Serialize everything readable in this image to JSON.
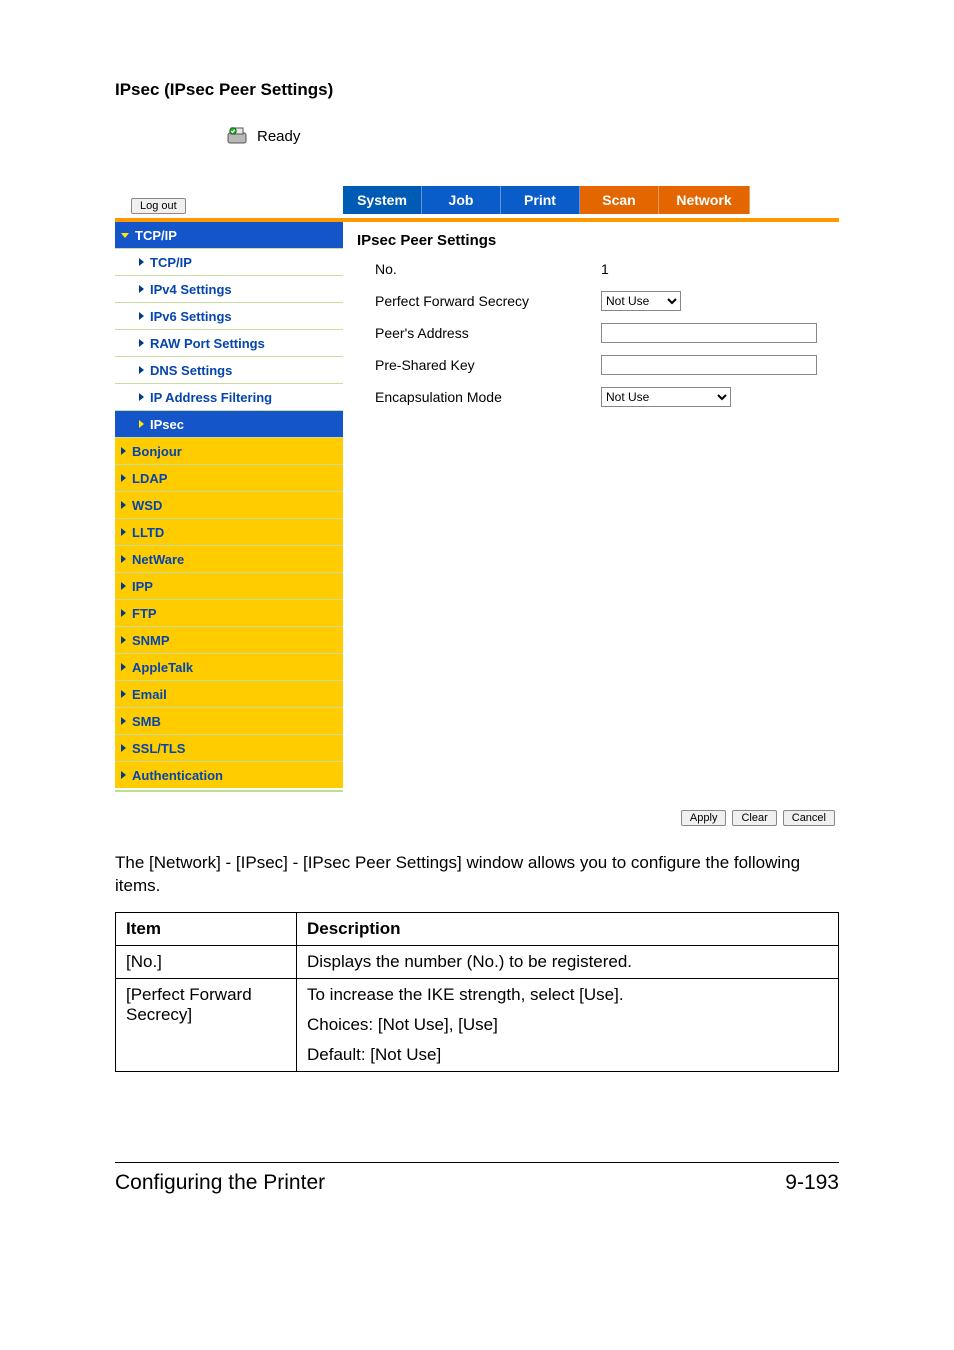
{
  "section_title": "IPsec (IPsec Peer Settings)",
  "status": {
    "text": "Ready"
  },
  "header": {
    "logout_label": "Log out",
    "tabs": {
      "system": "System",
      "job": "Job",
      "print": "Print",
      "scan": "Scan",
      "network": "Network"
    }
  },
  "sidebar": {
    "group": "TCP/IP",
    "subs": [
      "TCP/IP",
      "IPv4 Settings",
      "IPv6 Settings",
      "RAW Port Settings",
      "DNS Settings",
      "IP Address Filtering",
      "IPsec"
    ],
    "items": [
      "Bonjour",
      "LDAP",
      "WSD",
      "LLTD",
      "NetWare",
      "IPP",
      "FTP",
      "SNMP",
      "AppleTalk",
      "Email",
      "SMB",
      "SSL/TLS",
      "Authentication"
    ]
  },
  "panel": {
    "title": "IPsec Peer Settings",
    "rows": {
      "no_label": "No.",
      "no_value": "1",
      "pfs_label": "Perfect Forward Secrecy",
      "pfs_value": "Not Use",
      "peer_addr_label": "Peer's Address",
      "peer_addr_value": "",
      "psk_label": "Pre-Shared Key",
      "psk_value": "",
      "encap_label": "Encapsulation Mode",
      "encap_value": "Not Use"
    },
    "buttons": {
      "apply": "Apply",
      "clear": "Clear",
      "cancel": "Cancel"
    }
  },
  "caption": "The [Network] - [IPsec] - [IPsec Peer Settings] window allows you to configure the following items.",
  "table": {
    "headers": {
      "item": "Item",
      "description": "Description"
    },
    "rows": [
      {
        "item": "[No.]",
        "desc": [
          "Displays the number (No.) to be registered."
        ]
      },
      {
        "item": "[Perfect Forward Secrecy]",
        "desc": [
          "To increase the IKE strength, select [Use].",
          "Choices: [Not Use], [Use]",
          "Default:  [Not Use]"
        ]
      }
    ]
  },
  "footer": {
    "left": "Configuring the Printer",
    "right": "9-193"
  }
}
